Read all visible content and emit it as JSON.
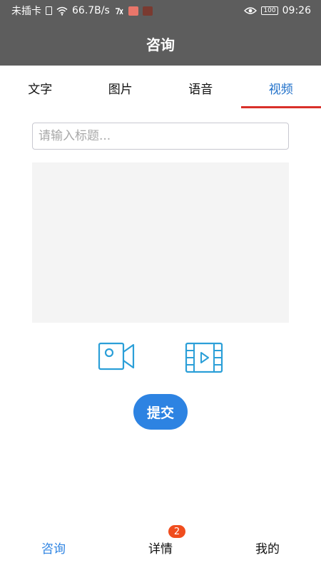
{
  "status_bar": {
    "carrier": "未插卡",
    "net_speed": "66.7B/s",
    "battery": "100",
    "time": "09:26"
  },
  "header": {
    "title": "咨询"
  },
  "tabs": [
    {
      "label": "文字"
    },
    {
      "label": "图片"
    },
    {
      "label": "语音"
    },
    {
      "label": "视频",
      "active": true
    }
  ],
  "form": {
    "title_placeholder": "请输入标题...",
    "submit_label": "提交"
  },
  "icons": {
    "record": "video-camera-icon",
    "pick": "film-play-icon"
  },
  "bottom_nav": [
    {
      "label": "咨询",
      "active": true
    },
    {
      "label": "详情",
      "badge": "2"
    },
    {
      "label": "我的"
    }
  ],
  "colors": {
    "header_bg": "#5d5d5d",
    "accent": "#2d83e2",
    "tab_active": "#1e6fc9",
    "tab_underline": "#d9302a",
    "badge": "#f04d1e",
    "icon": "#2b9fd8"
  }
}
